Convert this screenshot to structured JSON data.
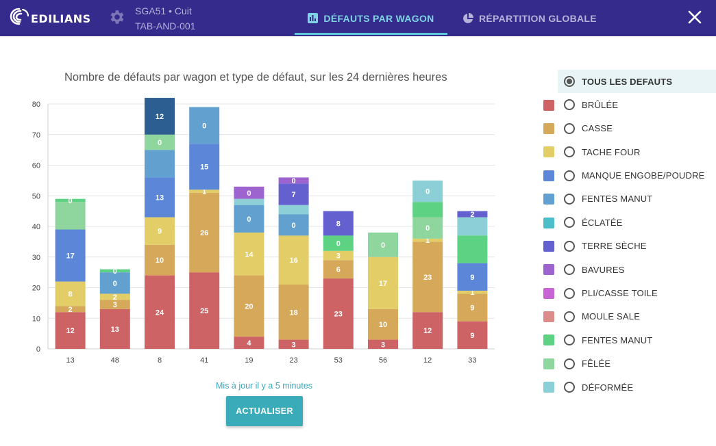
{
  "header": {
    "logo_text": "EDILIANS",
    "machine_line1": "SGA51 • Cuit",
    "machine_line2": "TAB-AND-001",
    "tabs": [
      {
        "label": "DÉFAUTS PAR WAGON",
        "active": true
      },
      {
        "label": "RÉPARTITION GLOBALE",
        "active": false
      }
    ]
  },
  "colors": {
    "header_bg": "#352b8c",
    "accent": "#3aabb8",
    "active_tab": "#7fd3e4"
  },
  "footer": {
    "updated": "Mis à jour il y a 5 minutes",
    "refresh_label": "ACTUALISER"
  },
  "legend": {
    "all_label": "TOUS LES DEFAUTS",
    "items": [
      {
        "label": "BRÛLÉE",
        "color": "#cd6365"
      },
      {
        "label": "CASSE",
        "color": "#d6a85a"
      },
      {
        "label": "TACHE FOUR",
        "color": "#e2cd66"
      },
      {
        "label": "MANQUE ENGOBE/POUDRE",
        "color": "#5c87d8"
      },
      {
        "label": "FENTES MANUT",
        "color": "#62a1cf"
      },
      {
        "label": "ÉCLATÉE",
        "color": "#4ebec9"
      },
      {
        "label": "TERRE SÈCHE",
        "color": "#6460cf"
      },
      {
        "label": "BAVURES",
        "color": "#9d63cf"
      },
      {
        "label": "PLI/CASSE TOILE",
        "color": "#c865d4"
      },
      {
        "label": "MOULE SALE",
        "color": "#dd8c8c"
      },
      {
        "label": "FENTES MANUT",
        "color": "#5dd283"
      },
      {
        "label": "FÊLÉE",
        "color": "#8fd69e"
      },
      {
        "label": "DÉFORMÉE",
        "color": "#8dcfd6"
      }
    ]
  },
  "chart_data": {
    "type": "bar",
    "stacked": true,
    "title": "Nombre de défauts par wagon et type de défaut, sur les 24 dernières heures",
    "xlabel": "",
    "ylabel": "",
    "ylim": [
      0,
      80
    ],
    "yticks": [
      0,
      10,
      20,
      30,
      40,
      50,
      60,
      70,
      80
    ],
    "grid": true,
    "legend_position": "right",
    "categories": [
      "13",
      "48",
      "8",
      "41",
      "19",
      "23",
      "53",
      "56",
      "12",
      "33"
    ],
    "bars": [
      {
        "category": "13",
        "segments": [
          {
            "type": "BRÛLÉE",
            "value": 12,
            "label": "12"
          },
          {
            "type": "CASSE",
            "value": 2,
            "label": "2"
          },
          {
            "type": "TACHE FOUR",
            "value": 8,
            "label": "8"
          },
          {
            "type": "MANQUE ENGOBE/POUDRE",
            "value": 17,
            "label": "17"
          },
          {
            "type": "FÊLÉE",
            "value": 9,
            "label": ""
          },
          {
            "type": "FENTES MANUT",
            "value": 1,
            "label": "0",
            "color": "#5dd283"
          }
        ]
      },
      {
        "category": "48",
        "segments": [
          {
            "type": "BRÛLÉE",
            "value": 13,
            "label": "13"
          },
          {
            "type": "CASSE",
            "value": 3,
            "label": "3"
          },
          {
            "type": "TACHE FOUR",
            "value": 2,
            "label": "2"
          },
          {
            "type": "FENTES MANUT",
            "value": 7,
            "label": "0",
            "color": "#62a1cf"
          },
          {
            "type": "FENTES MANUT",
            "value": 1,
            "label": "0",
            "color": "#5dd283"
          }
        ]
      },
      {
        "category": "8",
        "segments": [
          {
            "type": "BRÛLÉE",
            "value": 24,
            "label": "24"
          },
          {
            "type": "CASSE",
            "value": 10,
            "label": "10"
          },
          {
            "type": "TACHE FOUR",
            "value": 9,
            "label": "9"
          },
          {
            "type": "MANQUE ENGOBE/POUDRE",
            "value": 13,
            "label": "13"
          },
          {
            "type": "FENTES MANUT",
            "value": 9,
            "label": "",
            "color": "#62a1cf"
          },
          {
            "type": "FÊLÉE",
            "value": 5,
            "label": "0"
          },
          {
            "type": "",
            "value": 12,
            "label": "12",
            "color": "#2c5e91"
          }
        ]
      },
      {
        "category": "41",
        "segments": [
          {
            "type": "BRÛLÉE",
            "value": 25,
            "label": "25"
          },
          {
            "type": "CASSE",
            "value": 26,
            "label": "26"
          },
          {
            "type": "TACHE FOUR",
            "value": 1,
            "label": "1"
          },
          {
            "type": "MANQUE ENGOBE/POUDRE",
            "value": 15,
            "label": "15"
          },
          {
            "type": "FENTES MANUT",
            "value": 12,
            "label": "0",
            "color": "#62a1cf"
          }
        ]
      },
      {
        "category": "19",
        "segments": [
          {
            "type": "BRÛLÉE",
            "value": 4,
            "label": "4"
          },
          {
            "type": "CASSE",
            "value": 20,
            "label": "20"
          },
          {
            "type": "TACHE FOUR",
            "value": 14,
            "label": "14"
          },
          {
            "type": "FENTES MANUT",
            "value": 9,
            "label": "0",
            "color": "#62a1cf"
          },
          {
            "type": "DÉFORMÉE",
            "value": 2,
            "label": ""
          },
          {
            "type": "BAVURES",
            "value": 4,
            "label": "0"
          }
        ]
      },
      {
        "category": "23",
        "segments": [
          {
            "type": "BRÛLÉE",
            "value": 3,
            "label": "3"
          },
          {
            "type": "CASSE",
            "value": 18,
            "label": "18"
          },
          {
            "type": "TACHE FOUR",
            "value": 16,
            "label": "16"
          },
          {
            "type": "FENTES MANUT",
            "value": 7,
            "label": "0",
            "color": "#62a1cf"
          },
          {
            "type": "DÉFORMÉE",
            "value": 3,
            "label": ""
          },
          {
            "type": "TERRE SÈCHE",
            "value": 7,
            "label": "7"
          },
          {
            "type": "BAVURES",
            "value": 2,
            "label": "0"
          }
        ]
      },
      {
        "category": "53",
        "segments": [
          {
            "type": "BRÛLÉE",
            "value": 23,
            "label": "23"
          },
          {
            "type": "CASSE",
            "value": 6,
            "label": "6"
          },
          {
            "type": "TACHE FOUR",
            "value": 3,
            "label": "3"
          },
          {
            "type": "FENTES MANUT",
            "value": 5,
            "label": "0",
            "color": "#5dd283"
          },
          {
            "type": "TERRE SÈCHE",
            "value": 8,
            "label": "8"
          }
        ]
      },
      {
        "category": "56",
        "segments": [
          {
            "type": "BRÛLÉE",
            "value": 3,
            "label": "3"
          },
          {
            "type": "CASSE",
            "value": 10,
            "label": "10"
          },
          {
            "type": "TACHE FOUR",
            "value": 17,
            "label": "17"
          },
          {
            "type": "FÊLÉE",
            "value": 8,
            "label": "0"
          }
        ]
      },
      {
        "category": "12",
        "segments": [
          {
            "type": "BRÛLÉE",
            "value": 12,
            "label": "12"
          },
          {
            "type": "CASSE",
            "value": 23,
            "label": "23"
          },
          {
            "type": "TACHE FOUR",
            "value": 1,
            "label": "1"
          },
          {
            "type": "FÊLÉE",
            "value": 7,
            "label": "0"
          },
          {
            "type": "FENTES MANUT",
            "value": 5,
            "label": "",
            "color": "#5dd283"
          },
          {
            "type": "DÉFORMÉE",
            "value": 7,
            "label": "0"
          }
        ]
      },
      {
        "category": "33",
        "segments": [
          {
            "type": "BRÛLÉE",
            "value": 9,
            "label": "9"
          },
          {
            "type": "CASSE",
            "value": 9,
            "label": "9"
          },
          {
            "type": "TACHE FOUR",
            "value": 1,
            "label": "1"
          },
          {
            "type": "MANQUE ENGOBE/POUDRE",
            "value": 9,
            "label": "9"
          },
          {
            "type": "FENTES MANUT",
            "value": 9,
            "label": "",
            "color": "#5dd283"
          },
          {
            "type": "DÉFORMÉE",
            "value": 6,
            "label": ""
          },
          {
            "type": "TERRE SÈCHE",
            "value": 2,
            "label": "2"
          }
        ]
      }
    ]
  }
}
